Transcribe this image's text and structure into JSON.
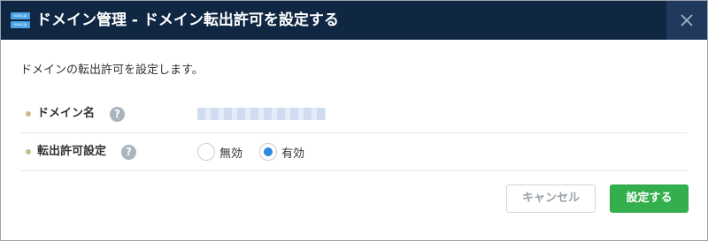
{
  "dialog": {
    "title": "ドメイン管理 - ドメイン転出許可を設定する",
    "logo_text_top": "xxxx.jp",
    "logo_text_bottom": "xxxx.jp",
    "description": "ドメインの転出許可を設定します。"
  },
  "fields": {
    "domain_name": {
      "label": "ドメイン名",
      "help": "?"
    },
    "transfer": {
      "label": "転出許可設定",
      "help": "?",
      "options": [
        "無効",
        "有効"
      ],
      "selected": "有効"
    }
  },
  "buttons": {
    "cancel": "キャンセル",
    "submit": "設定する"
  },
  "icons": {
    "close": "close-icon",
    "help": "help-icon",
    "logo": "logo-icon"
  },
  "colors": {
    "titlebar": "#0f2742",
    "radio_selected": "#2e87e0",
    "submit": "#33b04d"
  }
}
